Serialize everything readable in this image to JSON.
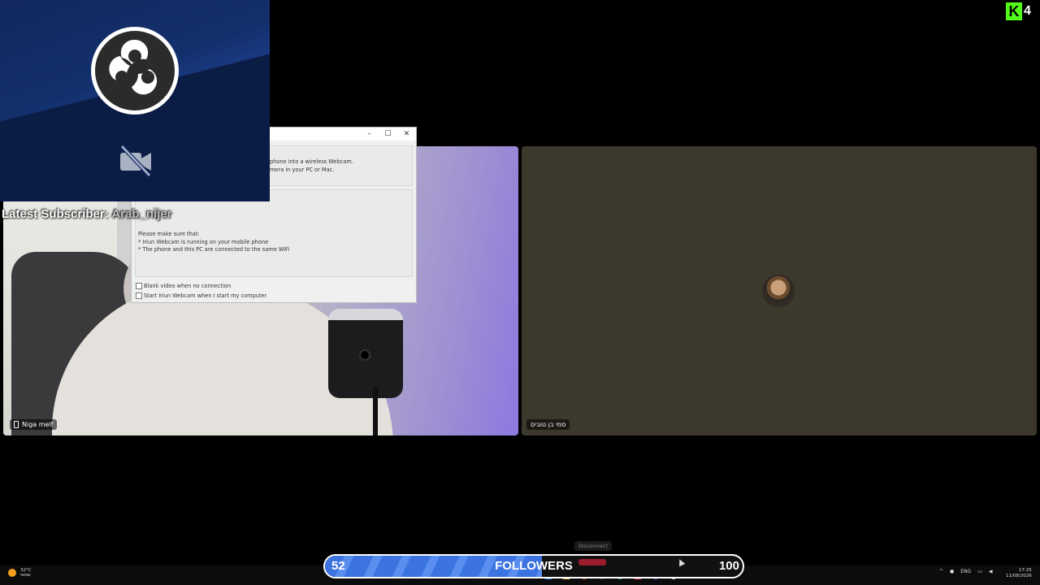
{
  "kick_logo": {
    "letter": "K",
    "count": "4"
  },
  "tiles": {
    "left": {
      "name": "Niga melf"
    },
    "right": {
      "name": "סמי בן טובים"
    }
  },
  "iriun": {
    "window_controls": [
      "–",
      "☐",
      "✕"
    ],
    "intro_line1": "phone into a wireless Webcam.",
    "intro_line2": "mera in your PC or Mac.",
    "make_sure": "Please make sure that:",
    "bullet1": "* Iriun Webcam is running on your mobile phone",
    "bullet2": "* The phone and this PC are connected to the same WiFi",
    "checkbox1": "Blank video when no connection",
    "checkbox2": "Start Iriun Webcam when I start my computer"
  },
  "overlay": {
    "latest_sub_label": "Latest Subscriber: ",
    "latest_sub_value": "Arab_nijer"
  },
  "goal": {
    "current": 52,
    "target": 100,
    "label": "FOLLOWERS",
    "progress": 0.52,
    "tooltip": "Disconnect"
  },
  "taskbar": {
    "weather_temp": "32°C",
    "weather_desc": "שמשי",
    "lang": "ENG",
    "time": "17:25",
    "date": "11/08/2026"
  },
  "colors": {
    "kick_green": "#53fc18",
    "goal_blue": "#3b73e0",
    "obs_navy": "#13306d"
  }
}
